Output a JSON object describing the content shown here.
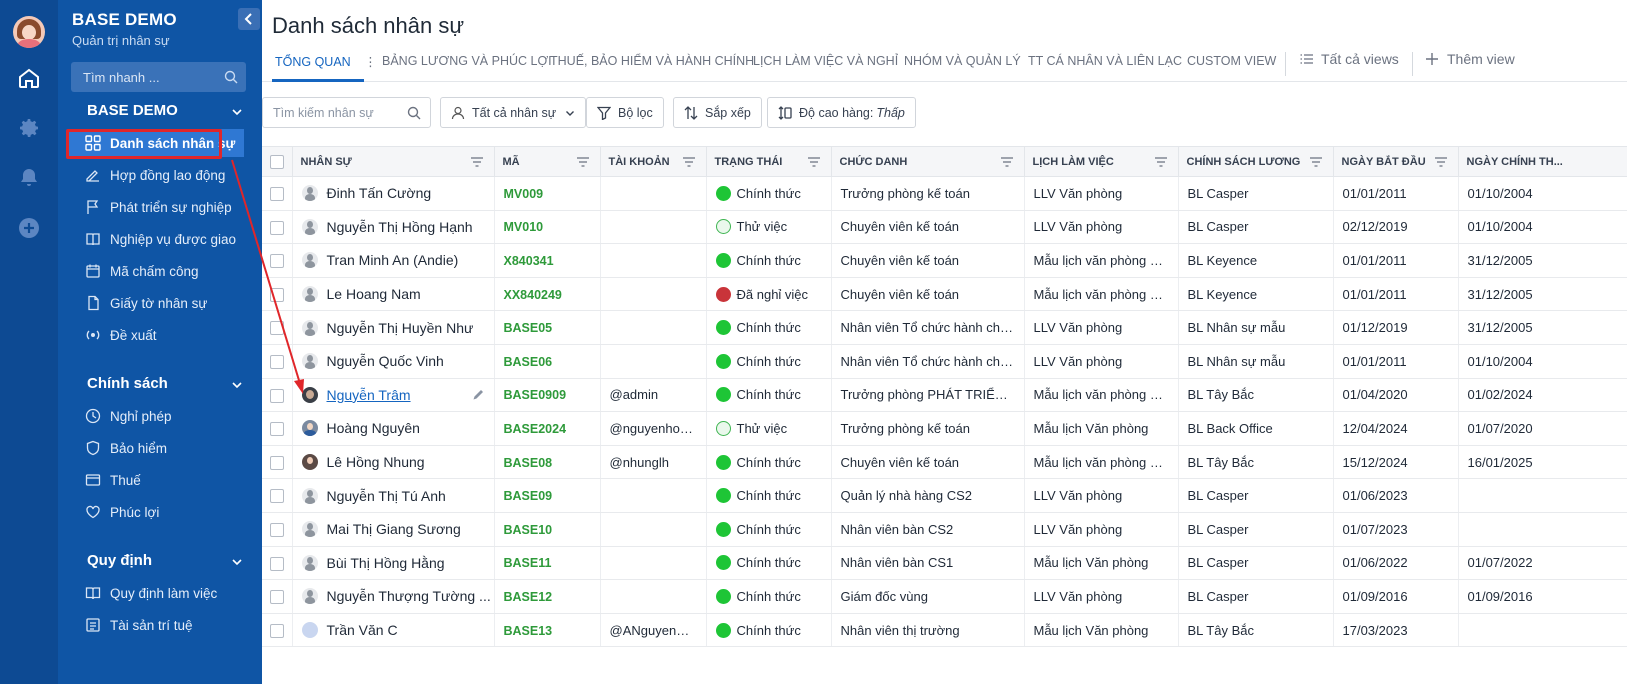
{
  "sidebar": {
    "brand": "BASE DEMO",
    "brand_sub": "Quản trị nhân sự",
    "quick_search_placeholder": "Tìm nhanh ...",
    "sections": [
      {
        "title": "BASE DEMO"
      },
      {
        "title": "Chính sách"
      },
      {
        "title": "Quy định"
      }
    ],
    "items": [
      {
        "label": "Danh sách nhân sự"
      },
      {
        "label": "Hợp đồng lao động"
      },
      {
        "label": "Phát triển sự nghiệp"
      },
      {
        "label": "Nghiệp vụ được giao"
      },
      {
        "label": "Mã chấm công"
      },
      {
        "label": "Giấy tờ nhân sự"
      },
      {
        "label": "Đề xuất"
      },
      {
        "label": "Nghỉ phép"
      },
      {
        "label": "Bảo hiểm"
      },
      {
        "label": "Thuế"
      },
      {
        "label": "Phúc lợi"
      },
      {
        "label": "Quy định làm việc"
      },
      {
        "label": "Tài sản trí tuệ"
      }
    ]
  },
  "main": {
    "title": "Danh sách nhân sự",
    "tabs": [
      {
        "label": "TỔNG QUAN"
      },
      {
        "label": "BẢNG LƯƠNG VÀ PHÚC LỢI"
      },
      {
        "label": "THUẾ, BẢO HIỂM VÀ HÀNH CHÍNH"
      },
      {
        "label": "LỊCH LÀM VIỆC VÀ NGHỈ"
      },
      {
        "label": "NHÓM VÀ QUẢN LÝ"
      },
      {
        "label": "TT CÁ NHÂN VÀ LIÊN LẠC"
      },
      {
        "label": "CUSTOM VIEW"
      }
    ],
    "all_views": "Tất cả views",
    "add_view": "Thêm view",
    "toolbar": {
      "search_placeholder": "Tìm kiếm nhân sự",
      "all_staff": "Tất cả nhân sự",
      "filter": "Bộ lọc",
      "sort": "Sắp xếp",
      "row_height_label": "Độ cao hàng:",
      "row_height_value": "Thấp"
    }
  },
  "table": {
    "columns": [
      "NHÂN SỰ",
      "MÃ",
      "TÀI KHOẢN",
      "TRẠNG THÁI",
      "CHỨC DANH",
      "LỊCH LÀM VIỆC",
      "CHÍNH SÁCH LƯƠNG",
      "NGÀY BẮT ĐẦU",
      "NGÀY CHÍNH TH..."
    ],
    "rows": [
      {
        "name": "Đinh Tấn Cường",
        "code": "MV009",
        "account": "",
        "status": "Chính thức",
        "status_type": "on",
        "title": "Trưởng phòng kế toán",
        "schedule": "LLV Văn phòng",
        "salary": "BL Casper",
        "start": "01/01/2011",
        "official": "01/10/2004",
        "avatar": "person"
      },
      {
        "name": "Nguyễn Thị Hồng Hạnh",
        "code": "MV010",
        "account": "",
        "status": "Thử việc",
        "status_type": "trial",
        "title": "Chuyên viên kế toán",
        "schedule": "LLV Văn phòng",
        "salary": "BL Casper",
        "start": "02/12/2019",
        "official": "01/10/2004",
        "avatar": "person"
      },
      {
        "name": "Tran Minh An (Andie)",
        "code": "X840341",
        "account": "",
        "status": "Chính thức",
        "status_type": "on",
        "title": "Chuyên viên kế toán",
        "schedule": "Mẫu lịch văn phòng cố...",
        "salary": "BL Keyence",
        "start": "01/01/2011",
        "official": "31/12/2005",
        "avatar": "person"
      },
      {
        "name": "Le Hoang Nam",
        "code": "XX840249",
        "account": "",
        "status": "Đã nghỉ việc",
        "status_type": "off",
        "title": "Chuyên viên kế toán",
        "schedule": "Mẫu lịch văn phòng cố...",
        "salary": "BL Keyence",
        "start": "01/01/2011",
        "official": "31/12/2005",
        "avatar": "person"
      },
      {
        "name": "Nguyễn Thị Huyền Như",
        "code": "BASE05",
        "account": "",
        "status": "Chính thức",
        "status_type": "on",
        "title": "Nhân viên Tổ chức hành chính",
        "schedule": "LLV Văn phòng",
        "salary": "BL Nhân sự mẫu",
        "start": "01/12/2019",
        "official": "31/12/2005",
        "avatar": "person"
      },
      {
        "name": "Nguyễn Quốc Vinh",
        "code": "BASE06",
        "account": "",
        "status": "Chính thức",
        "status_type": "on",
        "title": "Nhân viên Tổ chức hành chính",
        "schedule": "LLV Văn phòng",
        "salary": "BL Nhân sự mẫu",
        "start": "01/01/2011",
        "official": "01/10/2004",
        "avatar": "person"
      },
      {
        "name": "Nguyễn Trâm",
        "code": "BASE0909",
        "account": "@admin",
        "status": "Chính thức",
        "status_type": "on",
        "title": "Trưởng phòng PHÁT TRIỂN Đ...",
        "schedule": "Mẫu lịch văn phòng cố...",
        "salary": "BL Tây Bắc",
        "start": "01/04/2020",
        "official": "01/02/2024",
        "avatar": "dark",
        "link": true
      },
      {
        "name": "Hoàng Nguyên",
        "code": "BASE2024",
        "account": "@nguyenhoang",
        "status": "Thử việc",
        "status_type": "trial",
        "title": "Trưởng phòng kế toán",
        "schedule": "Mẫu lịch Văn phòng",
        "salary": "BL Back Office",
        "start": "12/04/2024",
        "official": "01/07/2020",
        "avatar": "photo"
      },
      {
        "name": "Lê Hồng Nhung",
        "code": "BASE08",
        "account": "@nhunglh",
        "status": "Chính thức",
        "status_type": "on",
        "title": "Chuyên viên kế toán",
        "schedule": "Mẫu lịch văn phòng cố...",
        "salary": "BL Tây Bắc",
        "start": "15/12/2024",
        "official": "16/01/2025",
        "avatar": "photo2"
      },
      {
        "name": "Nguyễn Thị Tú Anh",
        "code": "BASE09",
        "account": "",
        "status": "Chính thức",
        "status_type": "on",
        "title": "Quản lý nhà hàng CS2",
        "schedule": "LLV Văn phòng",
        "salary": "BL Casper",
        "start": "01/06/2023",
        "official": "",
        "avatar": "person"
      },
      {
        "name": "Mai Thị Giang Sương",
        "code": "BASE10",
        "account": "",
        "status": "Chính thức",
        "status_type": "on",
        "title": "Nhân viên bàn CS2",
        "schedule": "LLV Văn phòng",
        "salary": "BL Casper",
        "start": "01/07/2023",
        "official": "",
        "avatar": "person"
      },
      {
        "name": "Bùi Thị Hồng Hằng",
        "code": "BASE11",
        "account": "",
        "status": "Chính thức",
        "status_type": "on",
        "title": "Nhân viên bàn CS1",
        "schedule": "Mẫu lịch Văn phòng",
        "salary": "BL Casper",
        "start": "01/06/2022",
        "official": "01/07/2022",
        "avatar": "person"
      },
      {
        "name": "Nguyễn Thượng Tường ...",
        "code": "BASE12",
        "account": "",
        "status": "Chính thức",
        "status_type": "on",
        "title": "Giám đốc vùng",
        "schedule": "LLV Văn phòng",
        "salary": "BL Casper",
        "start": "01/09/2016",
        "official": "01/09/2016",
        "avatar": "person"
      },
      {
        "name": "Trần Văn C",
        "code": "BASE13",
        "account": "@ANguyenVan",
        "status": "Chính thức",
        "status_type": "on",
        "title": "Nhân viên thị trường",
        "schedule": "Mẫu lịch Văn phòng",
        "salary": "BL Tây Bắc",
        "start": "17/03/2023",
        "official": "",
        "avatar": "light"
      }
    ]
  },
  "colors": {
    "rail": "#0d4a93",
    "sidebar": "#0f55a5",
    "active_item": "#2f78d3",
    "accent": "#1565c0",
    "code_green": "#2e9a3a",
    "status_on": "#1ec536",
    "status_off": "#c9343a",
    "annotation_red": "#e0262a"
  }
}
